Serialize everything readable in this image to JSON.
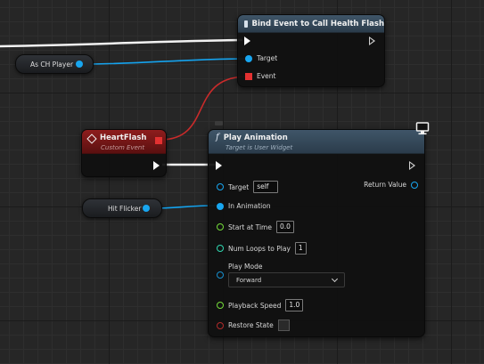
{
  "colors": {
    "exec_wire": "#f5f5f5",
    "object_wire": "#15a3ee",
    "delegate_wire": "#c92b2b",
    "event_header": "#8e1d1d",
    "function_header": "#3f5568"
  },
  "bind_node": {
    "title": "Bind Event to Call Health Flash",
    "pins": {
      "target": "Target",
      "event": "Event"
    }
  },
  "variable_nodes": {
    "as_player": "As CH Player",
    "hit_flicker": "Hit Flicker"
  },
  "event_node": {
    "title": "HeartFlash",
    "subtitle": "Custom Event"
  },
  "play_node": {
    "title": "Play Animation",
    "subtitle": "Target is User Widget",
    "icons": {
      "function": "f",
      "widget": "monitor-icon"
    },
    "pins": {
      "target": {
        "label": "Target",
        "value": "self"
      },
      "return_value": "Return Value",
      "in_animation": "In Animation",
      "start_at_time": {
        "label": "Start at Time",
        "value": "0.0"
      },
      "num_loops": {
        "label": "Num Loops to Play",
        "value": "1"
      },
      "play_mode": {
        "label": "Play Mode",
        "value": "Forward"
      },
      "playback_speed": {
        "label": "Playback Speed",
        "value": "1.0"
      },
      "restore_state": {
        "label": "Restore State",
        "checked": false
      }
    }
  }
}
